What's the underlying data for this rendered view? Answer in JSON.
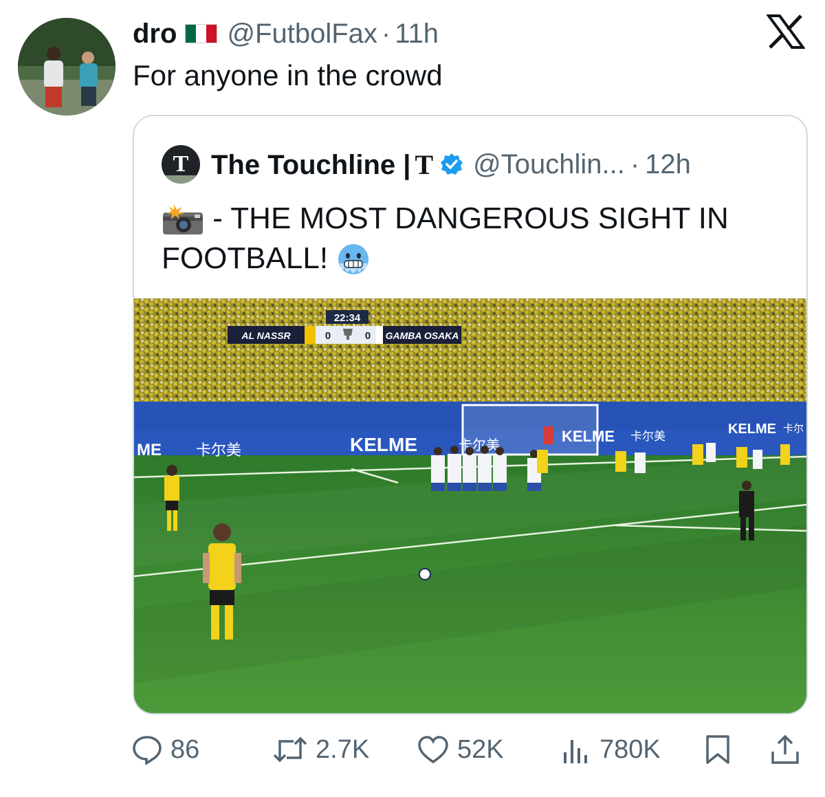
{
  "tweet": {
    "author_name": "dro",
    "author_flag": "mexico-flag-icon",
    "handle": "@FutbolFax",
    "separator": "·",
    "time": "11h",
    "text": "For anyone in the crowd"
  },
  "quoted": {
    "author_name": "The Touchline |",
    "author_mark": "T",
    "avatar_letter": "T",
    "handle": "@Touchlin...",
    "separator": "·",
    "time": "12h",
    "text": " - THE MOST DANGEROUS SIGHT IN FOOTBALL! ",
    "media": {
      "scoreboard": {
        "clock": "22:34",
        "home_team": "AL NASSR",
        "home_score": "0",
        "away_score": "0",
        "away_team": "GAMBA OSAKA"
      },
      "ad_boards": [
        "ME",
        "卡尔美",
        "KELME",
        "卡尔美",
        "KELME",
        "卡尔美",
        "KELME",
        "卡尔"
      ]
    }
  },
  "actions": {
    "replies": "86",
    "reposts": "2.7K",
    "likes": "52K",
    "views": "780K"
  },
  "colors": {
    "text": "#0f1419",
    "secondary": "#536471",
    "border": "#cfd9de",
    "verified": "#1d9bf0",
    "pitch": "#3f8a32",
    "crowd": "#c9b62a"
  }
}
